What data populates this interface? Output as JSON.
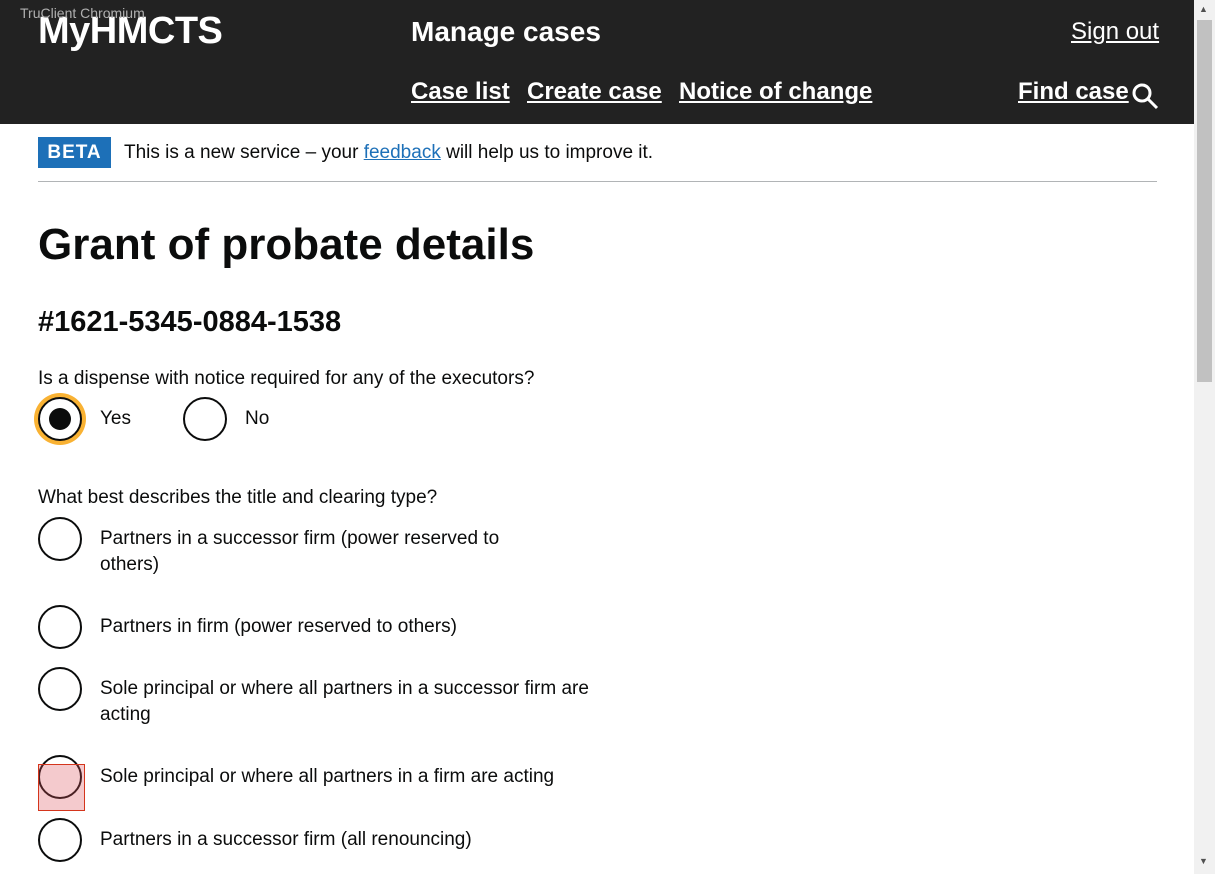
{
  "overlay": "TruClient Chromium",
  "header": {
    "brand": "MyHMCTS",
    "service": "Manage cases",
    "sign_out": "Sign out",
    "nav": [
      "Case list",
      "Create case",
      "Notice of change"
    ],
    "find_case": "Find case"
  },
  "beta": {
    "tag": "BETA",
    "text_before": "This is a new service – your ",
    "link": "feedback",
    "text_after": " will help us to improve it."
  },
  "page": {
    "title": "Grant of probate details",
    "case_ref": "#1621-5345-0884-1538"
  },
  "q1": {
    "label": "Is a dispense with notice required for any of the executors?",
    "options": [
      "Yes",
      "No"
    ],
    "selected": "Yes"
  },
  "q2": {
    "label": "What best describes the title and clearing type?",
    "options": [
      "Partners in a successor firm (power reserved to others)",
      "Partners in firm (power reserved to others)",
      "Sole principal or where all partners in a successor firm are acting",
      "Sole principal or where all partners in a firm are acting",
      "Partners in a successor firm (all renouncing)"
    ]
  },
  "colors": {
    "header_bg": "#222222",
    "beta_blue": "#1d70b8",
    "focus_ring": "#f9b233",
    "highlight": "#d4351c"
  }
}
